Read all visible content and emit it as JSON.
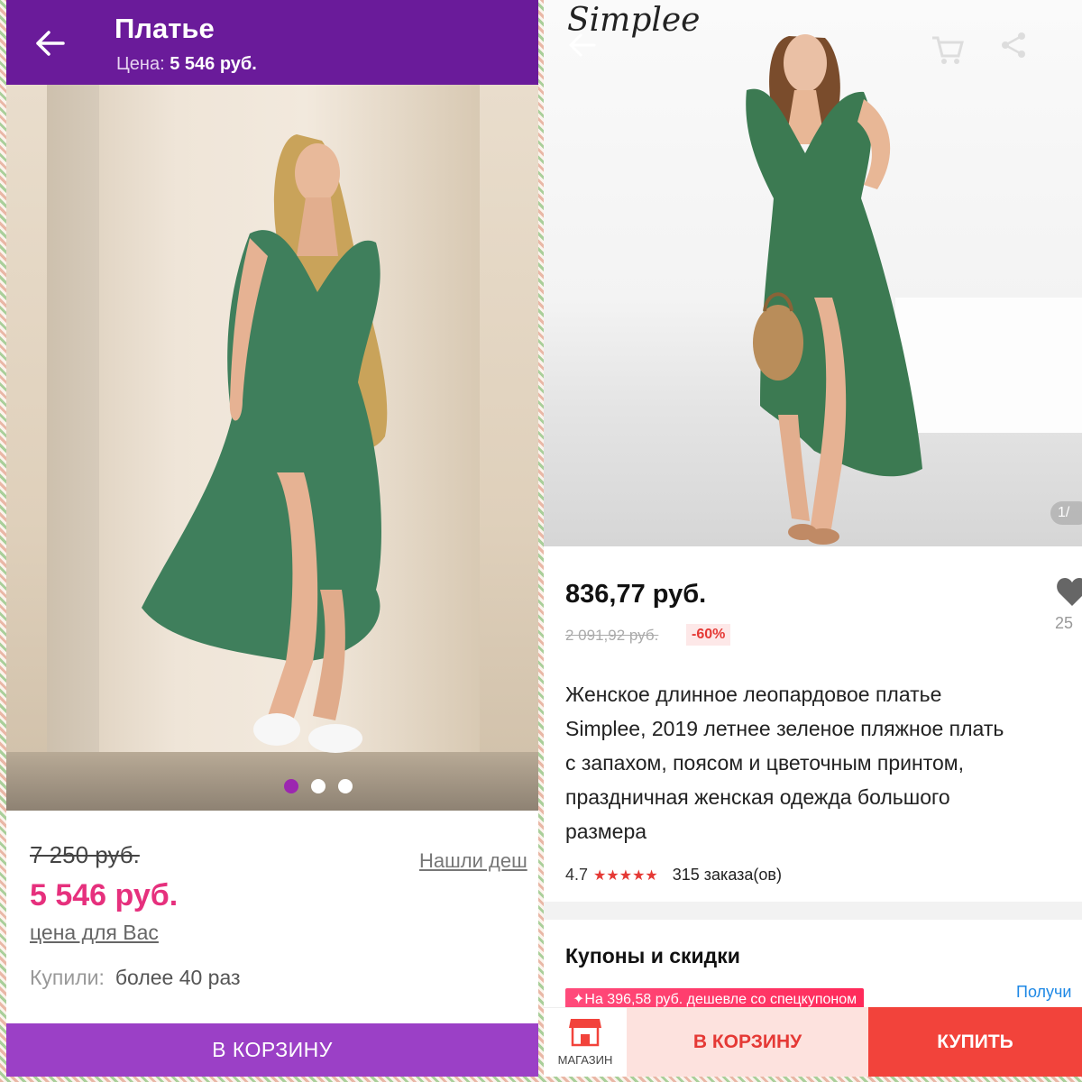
{
  "left": {
    "header": {
      "title": "Платье",
      "subtitle_label": "Цена:",
      "subtitle_price": "5 546 руб.",
      "color": "#6a1b9a"
    },
    "photo": {
      "slides": 3,
      "active_slide": 1
    },
    "price": {
      "old": "7 250 руб.",
      "current": "5 546 руб.",
      "for_you": "цена для Вас",
      "found_cheaper": "Нашли деш"
    },
    "bought": {
      "label": "Купили:",
      "value": "более 40 раз"
    },
    "cart_button": "В КОРЗИНУ",
    "accent": "#9b40c6",
    "price_color": "#e6307d"
  },
  "right": {
    "brand_logo": "Simplee",
    "icons": [
      "back-arrow-icon",
      "cart-icon",
      "share-icon",
      "heart-icon",
      "store-icon"
    ],
    "image_counter": "1/",
    "price": "836,77 руб.",
    "old_price": "2 091,92 руб.",
    "discount": "-60%",
    "favorites_count": "25",
    "description": "Женское длинное леопардовое платье\nSimplee, 2019 летнее зеленое пляжное плать\nс запахом, поясом и цветочным принтом,\nпраздничная женская одежда большого\nразмера",
    "rating": "4.7",
    "stars": "★★★★★",
    "orders": "315 заказа(ов)",
    "coupons": {
      "title": "Купоны и скидки",
      "coupon_text": "✦На 396,58 руб. дешевле со спецкупоном",
      "get_label": "Получи"
    },
    "bottom_bar": {
      "store_label": "МАГАЗИН",
      "cart_label": "В КОРЗИНУ",
      "buy_label": "КУПИТЬ"
    },
    "accent": "#f2433b"
  }
}
